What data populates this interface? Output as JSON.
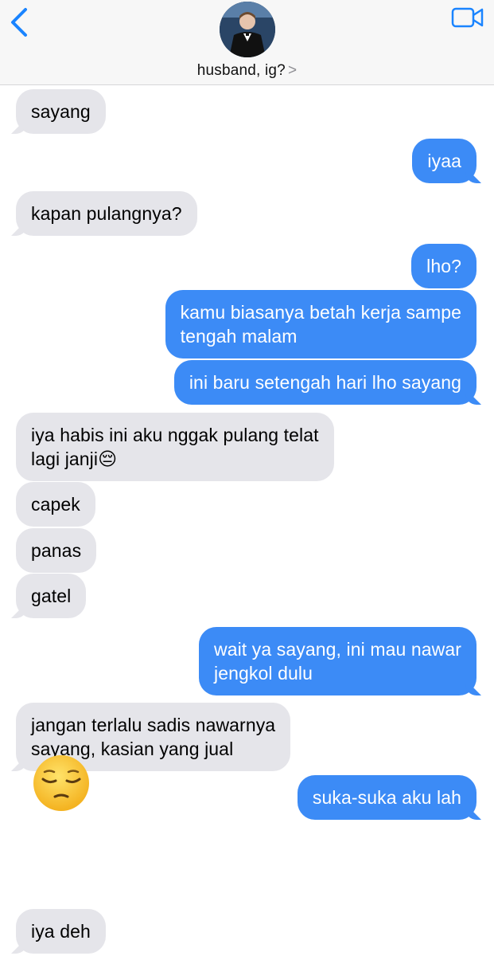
{
  "header": {
    "contact_name": "husband, ig?",
    "chevron": ">"
  },
  "colors": {
    "sent_bubble": "#3c8bf6",
    "received_bubble": "#e5e5ea",
    "accent": "#1a84ff"
  },
  "icons": {
    "back": "chevron-left-icon",
    "video": "video-camera-icon"
  },
  "messages": [
    {
      "from": "them",
      "text": "sayang"
    },
    {
      "from": "me",
      "text": "iyaa"
    },
    {
      "from": "them",
      "text": "kapan pulangnya?"
    },
    {
      "from": "me",
      "text": "lho?"
    },
    {
      "from": "me",
      "text": "kamu biasanya betah kerja sampe\ntengah malam"
    },
    {
      "from": "me",
      "text": "ini baru setengah hari lho sayang"
    },
    {
      "from": "them",
      "text": "iya habis ini aku nggak pulang telat\nlagi janji😔"
    },
    {
      "from": "them",
      "text": "capek"
    },
    {
      "from": "them",
      "text": "panas"
    },
    {
      "from": "them",
      "text": "gatel"
    },
    {
      "from": "me",
      "text": "wait ya sayang, ini mau nawar\njengkol dulu"
    },
    {
      "from": "them",
      "text": "jangan terlalu sadis nawarnya\nsayang, kasian yang jual"
    },
    {
      "from": "me",
      "text": "suka-suka aku lah"
    },
    {
      "from": "them",
      "text": "😔",
      "type": "big-emoji"
    },
    {
      "from": "them",
      "text": "iya deh"
    }
  ]
}
